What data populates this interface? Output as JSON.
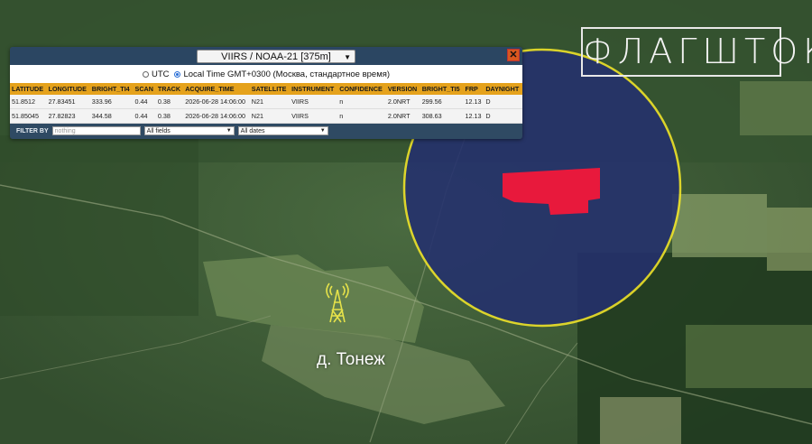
{
  "popup": {
    "product": "VIIRS / NOAA-21 [375m]",
    "close_glyph": "✕",
    "tz_utc": "UTC",
    "tz_local": "Local Time GMT+0300 (Москва, стандартное время)",
    "tz_selected": "local",
    "columns": [
      "LATITUDE",
      "LONGITUDE",
      "BRIGHT_TI4",
      "SCAN",
      "TRACK",
      "ACQUIRE_TIME",
      "SATELLITE",
      "INSTRUMENT",
      "CONFIDENCE",
      "VERSION",
      "BRIGHT_TI5",
      "FRP",
      "DAYNIGHT"
    ],
    "rows": [
      [
        "51.8512",
        "27.83451",
        "333.96",
        "0.44",
        "0.38",
        "2026-06-28 14:06:00",
        "N21",
        "VIIRS",
        "n",
        "2.0NRT",
        "299.56",
        "12.13",
        "D"
      ],
      [
        "51.85045",
        "27.82823",
        "344.58",
        "0.44",
        "0.38",
        "2026-06-28 14:06:00",
        "N21",
        "VIIRS",
        "n",
        "2.0NRT",
        "308.63",
        "12.13",
        "D"
      ]
    ],
    "filter_label": "FILTER BY",
    "filter_placeholder": "nothing",
    "filter_field": "All fields",
    "filter_dates": "All dates"
  },
  "logo": "ФЛАГШТОК",
  "village_label": "д. Тонеж",
  "colors": {
    "accent_header": "#e5a21c",
    "circle_fill": "#24306e",
    "circle_stroke": "#f2e52a",
    "hotspot": "#e8193c",
    "tower": "#e6e24a"
  },
  "icons": {
    "tower": "radio-tower-icon",
    "caret": "chevron-down-icon"
  }
}
